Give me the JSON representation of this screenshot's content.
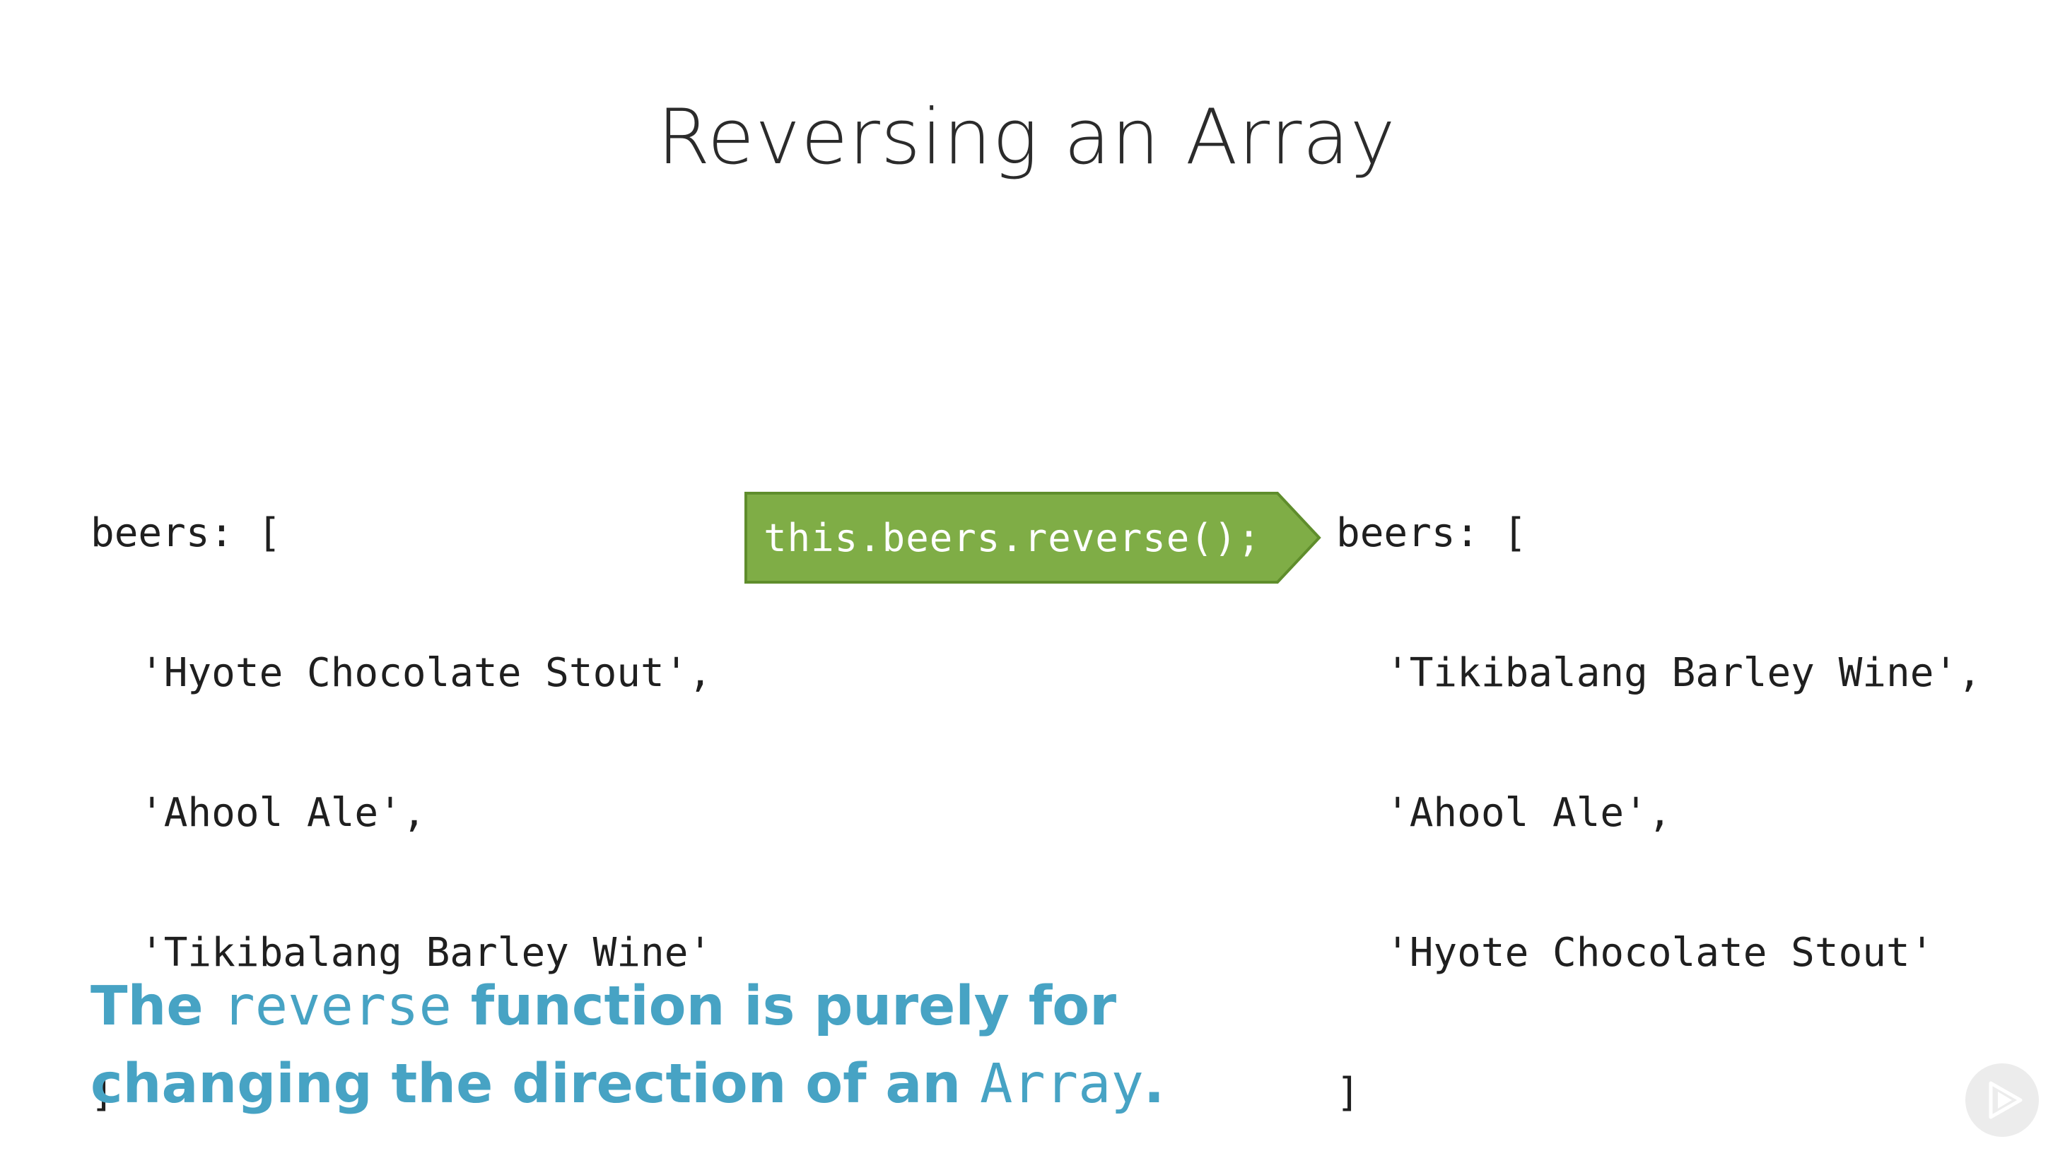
{
  "slide": {
    "title": "Reversing an Array"
  },
  "before": {
    "open": "beers: [",
    "items": [
      "'Hyote Chocolate Stout',",
      "'Ahool Ale',",
      "'Tikibalang Barley Wine'"
    ],
    "close": "]"
  },
  "arrow": {
    "code": "this.beers.reverse();",
    "fill_color": "#7fad46",
    "border_color": "#5f8d2c"
  },
  "after": {
    "open": "beers: [",
    "items": [
      "'Tikibalang Barley Wine',",
      "'Ahool Ale',",
      "'Hyote Chocolate Stout'"
    ],
    "close": "]"
  },
  "caption": {
    "line1_prefix": "The ",
    "line1_code": "reverse",
    "line1_suffix": " function is purely for",
    "line2_prefix": "changing the direction of an ",
    "line2_code": "Array",
    "line2_suffix": ".",
    "color": "#47a3c4"
  },
  "logo": {
    "icon": "play-logo-icon"
  }
}
